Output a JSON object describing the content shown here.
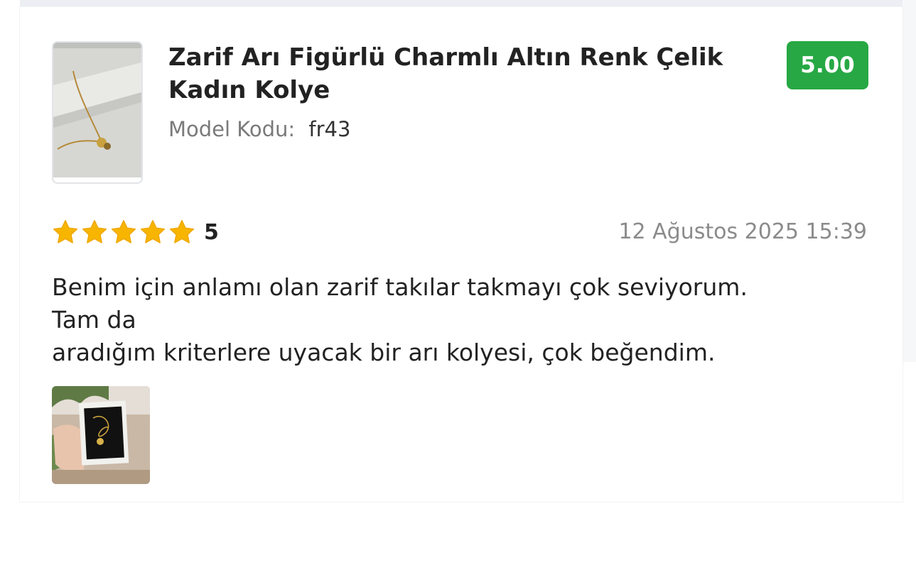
{
  "product": {
    "title": "Zarif Arı Figürlü Charmlı Altın Renk Çelik Kadın Kolye",
    "model_label": "Model Kodu:",
    "model_code": "fr43",
    "score": "5.00"
  },
  "review": {
    "rating": 5,
    "rating_label": "5",
    "date": "12 Ağustos 2025 15:39",
    "text_lines": [
      "Benim için anlamı olan zarif takılar takmayı çok seviyorum.",
      "Tam da",
      "aradığım kriterlere uyacak bir arı kolyesi, çok beğendim."
    ]
  },
  "colors": {
    "badge": "#27a844",
    "star": "#f7b500",
    "text": "#222222",
    "muted": "#8b8b8b"
  },
  "icons": {
    "star": "star-icon"
  }
}
